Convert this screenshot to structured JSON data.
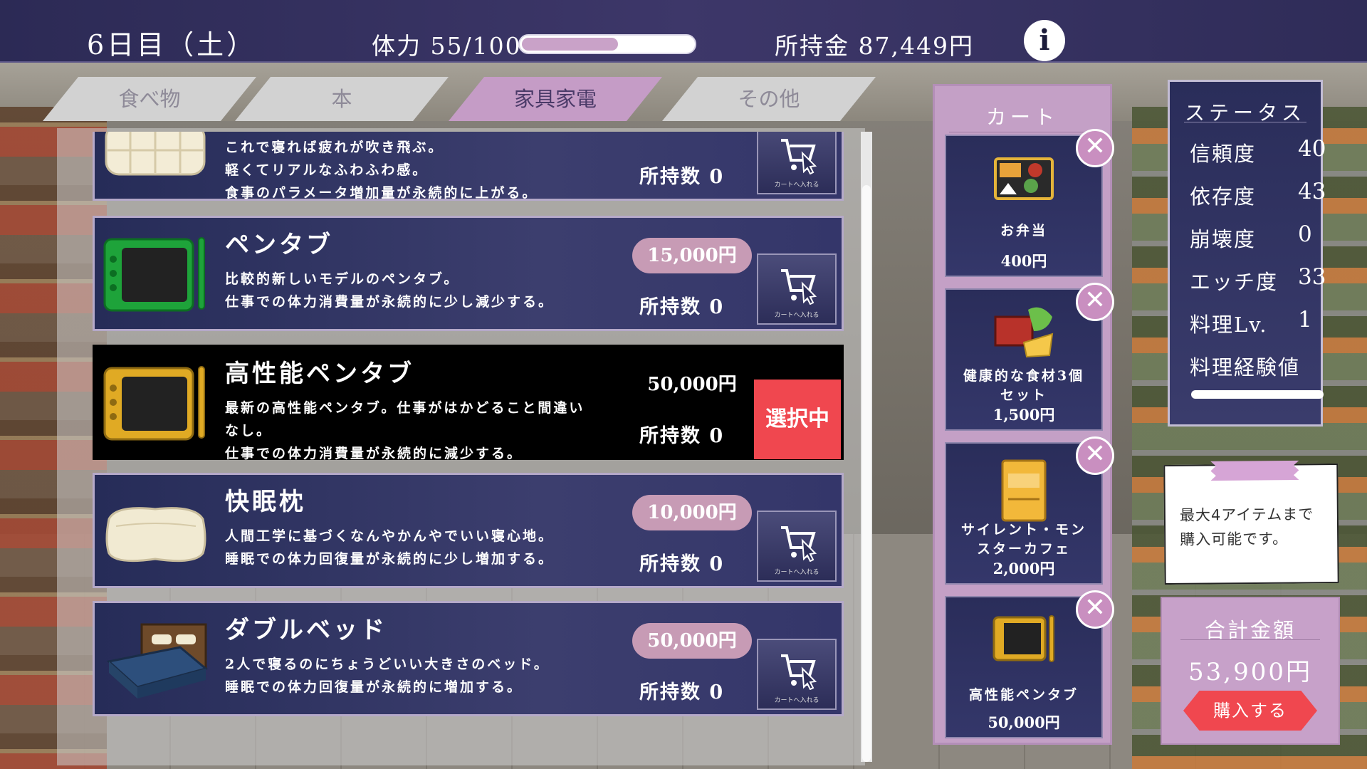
{
  "header": {
    "day": "6日目（土）",
    "stamina_label": "体力 55/100",
    "stamina_fraction": 0.55,
    "money_label": "所持金 87,449円",
    "info_icon": "i"
  },
  "tabs": [
    {
      "label": "食べ物",
      "active": false
    },
    {
      "label": "本",
      "active": false
    },
    {
      "label": "家具家電",
      "active": true
    },
    {
      "label": "その他",
      "active": false
    }
  ],
  "items": [
    {
      "name": "",
      "desc": [
        "これで寝れば疲れが吹き飛ぶ。",
        "軽くてリアルなふわふわ感。",
        "食事のパラメータ増加量が永続的に上がる。"
      ],
      "price": "",
      "owned": "所持数 0",
      "cart_caption": "カートへ入れる"
    },
    {
      "name": "ペンタブ",
      "desc": [
        "比較的新しいモデルのペンタブ。",
        "仕事での体力消費量が永続的に少し減少する。"
      ],
      "price": "15,000円",
      "owned": "所持数 0",
      "cart_caption": "カートへ入れる"
    },
    {
      "name": "高性能ペンタブ",
      "desc": [
        "最新の高性能ペンタブ。仕事がはかどること間違い",
        "なし。",
        "仕事での体力消費量が永続的に減少する。"
      ],
      "price": "50,000円",
      "owned": "所持数 0",
      "select_label": "選択中"
    },
    {
      "name": "快眠枕",
      "desc": [
        "人間工学に基づくなんやかんやでいい寝心地。",
        "睡眠での体力回復量が永続的に少し増加する。"
      ],
      "price": "10,000円",
      "owned": "所持数 0",
      "cart_caption": "カートへ入れる"
    },
    {
      "name": "ダブルベッド",
      "desc": [
        "2人で寝るのにちょうどいい大きさのベッド。",
        "睡眠での体力回復量が永続的に増加する。"
      ],
      "price": "50,000円",
      "owned": "所持数 0",
      "cart_caption": "カートへ入れる"
    }
  ],
  "cart": {
    "title": "カート",
    "items": [
      {
        "name": [
          "お弁当"
        ],
        "price": "400円"
      },
      {
        "name": [
          "健康的な食材3個",
          "セット"
        ],
        "price": "1,500円"
      },
      {
        "name": [
          "サイレント・モン",
          "スターカフェ"
        ],
        "price": "2,000円"
      },
      {
        "name": [
          "高性能ペンタブ"
        ],
        "price": "50,000円"
      }
    ]
  },
  "status": {
    "title": "ステータス",
    "stats": [
      {
        "label": "信頼度",
        "value": "40"
      },
      {
        "label": "依存度",
        "value": "43"
      },
      {
        "label": "崩壊度",
        "value": "0"
      },
      {
        "label": "エッチ度",
        "value": "33"
      },
      {
        "label": "料理Lv.",
        "value": "1"
      },
      {
        "label": "料理経験値",
        "value": ""
      }
    ]
  },
  "note": {
    "lines": [
      "最大4アイテムまで",
      "購入可能です。"
    ]
  },
  "total": {
    "label": "合計金額",
    "value": "53,900円",
    "buy_label": "購入する"
  },
  "colors": {
    "accent": "#c59cc6",
    "select": "#f0474f",
    "panel": "#2a2d5a"
  }
}
